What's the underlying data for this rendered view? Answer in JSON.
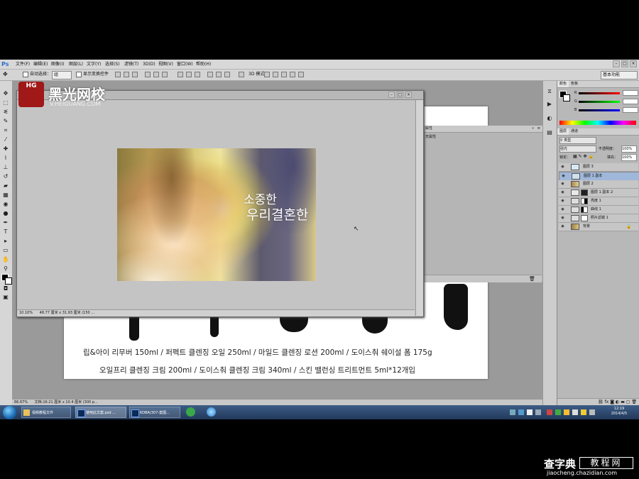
{
  "app": {
    "logo": "Ps",
    "menu": [
      "文件(F)",
      "编辑(E)",
      "图像(I)",
      "图层(L)",
      "文字(Y)",
      "选择(S)",
      "滤镜(T)",
      "3D(D)",
      "视图(V)",
      "窗口(W)",
      "帮助(H)"
    ]
  },
  "options_bar": {
    "auto_select_label": "自动选择：",
    "auto_select_value": "组",
    "show_transform_label": "显示变换控件",
    "mode_3d": "3D 模式：",
    "workspace": "基本功能"
  },
  "floating_doc": {
    "zoom": "10.10%",
    "doc_info": "48.77 厘米 x 31.93 厘米 (150 ..."
  },
  "photo": {
    "title_line1": "소중한",
    "title_line2": "우리결혼한"
  },
  "background_doc": {
    "line1": "립&아이 리무버 150ml / 퍼펙트 클렌징 오일 250ml / 마일드 클렌징 로션 200ml / 도이스춰 쉐이설 폼 175g",
    "line2": "오일프리 클렌징 크림 200ml / 도이스춰 클렌징 크림 340ml / 스킨 밸런싱 트리트먼트 5ml*12개입"
  },
  "properties": {
    "tab": "属性",
    "content": "无属性"
  },
  "color_panel": {
    "tabs": [
      "颜色",
      "色板"
    ],
    "r": "",
    "g": "",
    "b": ""
  },
  "layers_panel": {
    "tabs": [
      "图层",
      "通道"
    ],
    "kind": "类型",
    "blend_mode": "强光",
    "opacity_label": "不透明度：",
    "opacity_value": "100%",
    "lock_label": "锁定：",
    "fill_label": "填充：",
    "fill_value": "100%",
    "layers": [
      {
        "name": "图层 3",
        "selected": false
      },
      {
        "name": "图层 1 副本",
        "selected": true
      },
      {
        "name": "图层 2",
        "selected": false
      },
      {
        "name": "图层 1 副本 2",
        "selected": false
      },
      {
        "name": "亮度 1",
        "selected": false
      },
      {
        "name": "曲线 1",
        "selected": false
      },
      {
        "name": "照片滤镜 1",
        "selected": false
      },
      {
        "name": "背景",
        "selected": false
      }
    ]
  },
  "status": {
    "zoom": "66.67%",
    "doc_info": "文档:16.21 厘米 x 10.4 厘米 (300 p..."
  },
  "watermark": {
    "badge": "HG",
    "name": "黑光网校",
    "url": "V.HEIGUANG.COM"
  },
  "taskbar": {
    "items": [
      "视频教程文件",
      "使用此文案.psd ...",
      "KOBA(307-案图..."
    ],
    "clock_time": "12:19",
    "clock_date": "2014/4/5"
  },
  "footer_watermark": {
    "cn": "查字典",
    "box": "教程网",
    "url": "jiaocheng.chazidian.com"
  }
}
